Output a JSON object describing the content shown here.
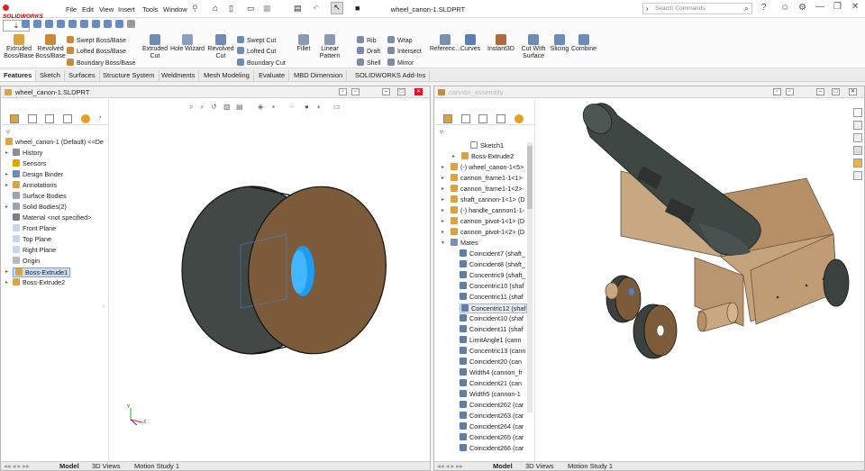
{
  "app": {
    "brand": "SOLIDWORKS",
    "menus": [
      "File",
      "Edit",
      "View",
      "Insert",
      "Tools",
      "Window"
    ],
    "doc_title": "wheel_canon-1.SLDPRT",
    "search_placeholder": "Search Commands"
  },
  "ribbon": {
    "large": [
      {
        "label": "Extruded Boss/Base",
        "icon": "extrude-boss-icon",
        "color": "#d9a441"
      },
      {
        "label": "Revolved Boss/Base",
        "icon": "revolve-boss-icon",
        "color": "#c98b3a"
      },
      {
        "label": "Extruded Cut",
        "icon": "extrude-cut-icon",
        "color": "#6e8bb8"
      },
      {
        "label": "Hole Wizard",
        "icon": "hole-wizard-icon",
        "color": "#8aa0c0"
      },
      {
        "label": "Revolved Cut",
        "icon": "revolve-cut-icon",
        "color": "#6e8bb8"
      },
      {
        "label": "Fillet",
        "icon": "fillet-icon",
        "color": "#8a9ab5"
      },
      {
        "label": "Linear Pattern",
        "icon": "linear-pattern-icon",
        "color": "#8a9ab5"
      },
      {
        "label": "Referenc...",
        "icon": "reference-geometry-icon",
        "color": "#7a8fb3"
      },
      {
        "label": "Curves",
        "icon": "curves-icon",
        "color": "#5b7fb5"
      },
      {
        "label": "Instant3D",
        "icon": "instant3d-icon",
        "color": "#b06a3a"
      },
      {
        "label": "Cut With Surface",
        "icon": "cut-with-surface-icon",
        "color": "#6e8bb8"
      },
      {
        "label": "Slicing",
        "icon": "slicing-icon",
        "color": "#6e8bb8"
      },
      {
        "label": "Combine",
        "icon": "combine-icon",
        "color": "#6e8bb8"
      }
    ],
    "small": [
      {
        "label": "Swept Boss/Base",
        "icon": "swept-boss-icon",
        "color": "#c98b3a"
      },
      {
        "label": "Lofted Boss/Base",
        "icon": "lofted-boss-icon",
        "color": "#c98b3a"
      },
      {
        "label": "Boundary Boss/Base",
        "icon": "boundary-boss-icon",
        "color": "#c98b3a"
      },
      {
        "label": "Swept Cut",
        "icon": "swept-cut-icon",
        "color": "#6e8bb8"
      },
      {
        "label": "Lofted Cut",
        "icon": "lofted-cut-icon",
        "color": "#6e8bb8"
      },
      {
        "label": "Boundary Cut",
        "icon": "boundary-cut-icon",
        "color": "#6e8bb8"
      },
      {
        "label": "Rib",
        "icon": "rib-icon",
        "color": "#7c8ca8"
      },
      {
        "label": "Draft",
        "icon": "draft-icon",
        "color": "#7c8ca8"
      },
      {
        "label": "Shell",
        "icon": "shell-icon",
        "color": "#7c8ca8"
      },
      {
        "label": "Wrap",
        "icon": "wrap-icon",
        "color": "#7c8ca8"
      },
      {
        "label": "Intersect",
        "icon": "intersect-icon",
        "color": "#7c8ca8"
      },
      {
        "label": "Mirror",
        "icon": "mirror-icon",
        "color": "#7c8ca8"
      }
    ]
  },
  "tabs": [
    "Features",
    "Sketch",
    "Surfaces",
    "Structure System",
    "Weldments",
    "Mesh Modeling",
    "Evaluate",
    "MBD Dimension",
    "SOLIDWORKS Add-Ins"
  ],
  "left_window": {
    "title": "wheel_canon-1.SLDPRT",
    "root": "wheel_canon-1 (Default) <<De",
    "items": [
      "History",
      "Sensors",
      "Design Binder",
      "Annotations",
      "Surface Bodies",
      "Solid Bodies(2)",
      "Material <not specified>",
      "Front Plane",
      "Top Plane",
      "Right Plane",
      "Origin",
      "Boss-Extrude1",
      "Boss-Extrude2"
    ],
    "bottom_tabs": [
      "Model",
      "3D Views",
      "Motion Study 1"
    ]
  },
  "right_window": {
    "title": "cannon_assembly",
    "items": [
      "Sketch1",
      "Boss-Extrude2",
      "(-) wheel_canon-1<5>",
      "cannon_frame1-1<1>",
      "cannon_frame1-1<2>",
      "shaft_cannon-1<1> (D",
      "(-) handle_cannon1-1-",
      "cannon_pivot-1<1> (D",
      "cannon_pivot-1<2> (D",
      "Mates",
      "Coincident7 (shaft_",
      "Coincident8 (shaft_",
      "Concentric9 (shaft_",
      "Concentric10 (shaf",
      "Concentric11 (shaf",
      "Concentric12 (shaf",
      "Coincident10 (shaf",
      "Coincident11 (shaf",
      "LimitAngle1 (cann",
      "Concentric13 (cann",
      "Coincident20 (can",
      "Width4 (cannon_fr",
      "Coincident21 (can",
      "Width5 (cannon-1",
      "Coincident262 (car",
      "Coincident263 (car",
      "Coincident264 (car",
      "Coincident265 (car",
      "Coincident266 (car"
    ],
    "bottom_tabs": [
      "Model",
      "3D Views",
      "Motion Study 1"
    ]
  }
}
